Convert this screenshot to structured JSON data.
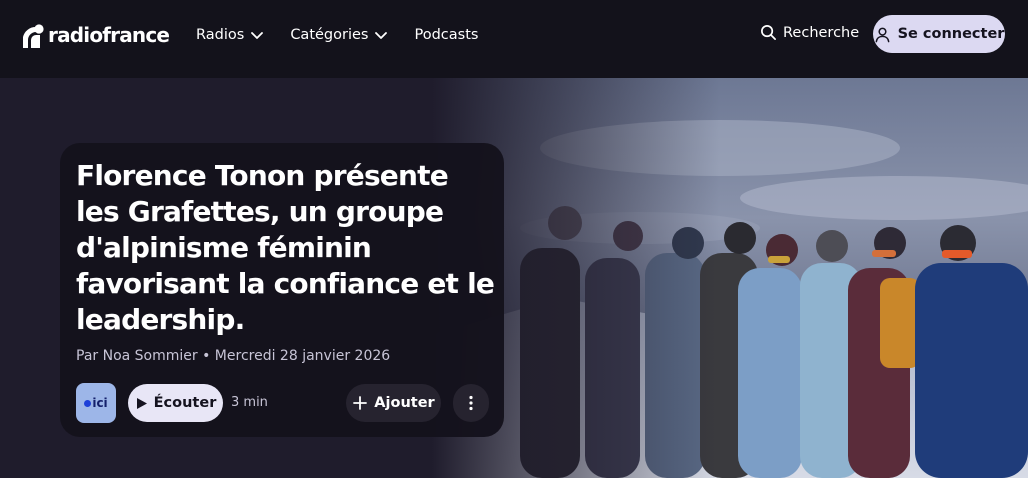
{
  "header": {
    "logo_text": "radiofrance",
    "nav": [
      {
        "label": "Radios",
        "has_dropdown": true
      },
      {
        "label": "Catégories",
        "has_dropdown": true
      },
      {
        "label": "Podcasts",
        "has_dropdown": false
      }
    ],
    "search_label": "Recherche",
    "login_label": "Se connecter"
  },
  "article": {
    "title": "Florence Tonon présente les Grafettes, un groupe d'alpinisme féminin favorisant la confiance et le leadership.",
    "meta": "Par Noa Sommier • Mercredi 28 janvier 2026",
    "station_logo": "ici",
    "listen_label": "Écouter",
    "duration": "3 min",
    "add_label": "Ajouter"
  },
  "icons": {
    "logo": "radiofrance-logo-icon",
    "chevron": "chevron-down-icon",
    "search": "search-icon",
    "user": "user-icon",
    "play": "play-icon",
    "plus": "plus-icon",
    "more": "more-vertical-icon"
  },
  "colors": {
    "header_bg": "#13121b",
    "page_bg": "#1f1c2c",
    "card_bg": "#14121c",
    "pill_light": "#e8e6f6",
    "login_bg": "#dcd9f2",
    "ici_badge": "#9db6e8"
  }
}
